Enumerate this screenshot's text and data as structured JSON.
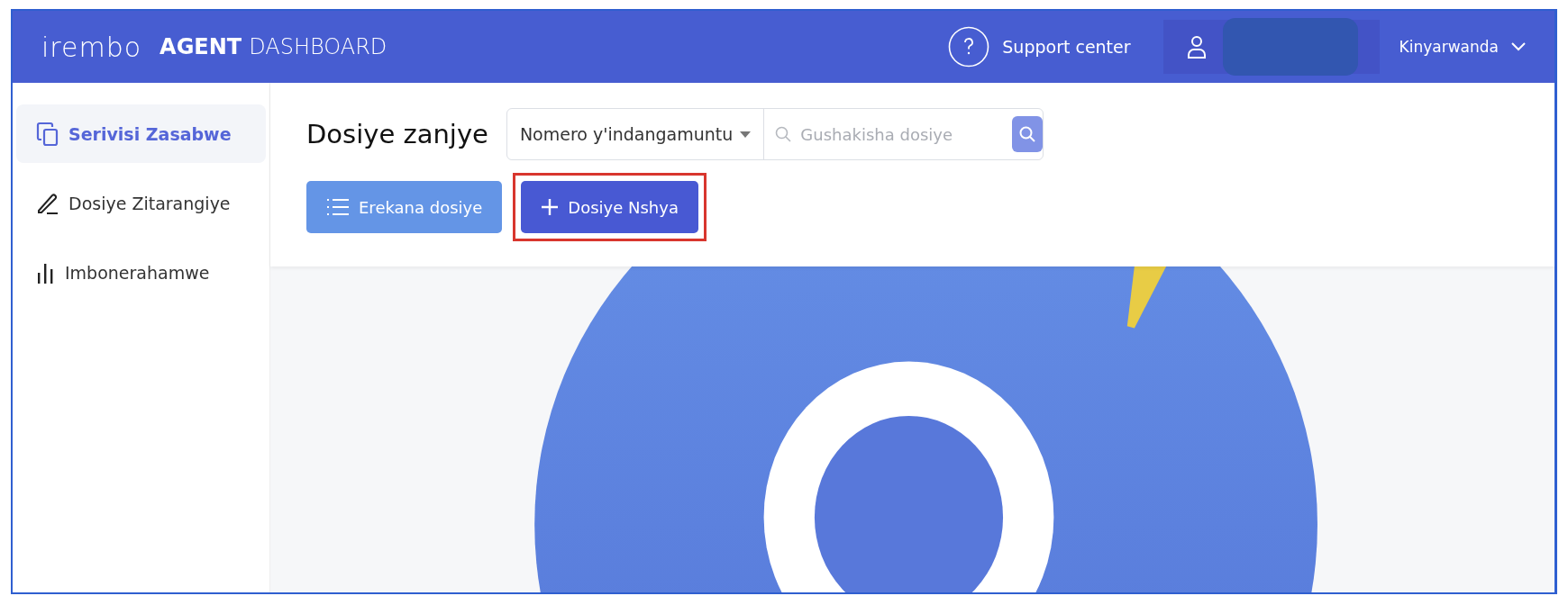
{
  "header": {
    "logo": "irembo",
    "title_bold": "AGENT",
    "title_rest": "DASHBOARD",
    "support": "Support center",
    "language": "Kinyarwanda"
  },
  "sidebar": {
    "items": [
      {
        "label": "Serivisi Zasabwe",
        "kind": "copy",
        "selected": true
      },
      {
        "label": "Dosiye Zitarangiye",
        "kind": "pen",
        "selected": false
      },
      {
        "label": "Imbonerahamwe",
        "kind": "bars",
        "selected": false
      }
    ]
  },
  "toolbar": {
    "title": "Dosiye zanjye",
    "search_type": "Nomero y'indangamuntu",
    "search": {
      "placeholder": "Gushakisha dosiye"
    },
    "buttons": [
      {
        "label": "Erekana dosiye",
        "kind": "list",
        "highlighted": false
      },
      {
        "label": "Dosiye Nshya",
        "kind": "add",
        "highlighted": true
      }
    ]
  }
}
